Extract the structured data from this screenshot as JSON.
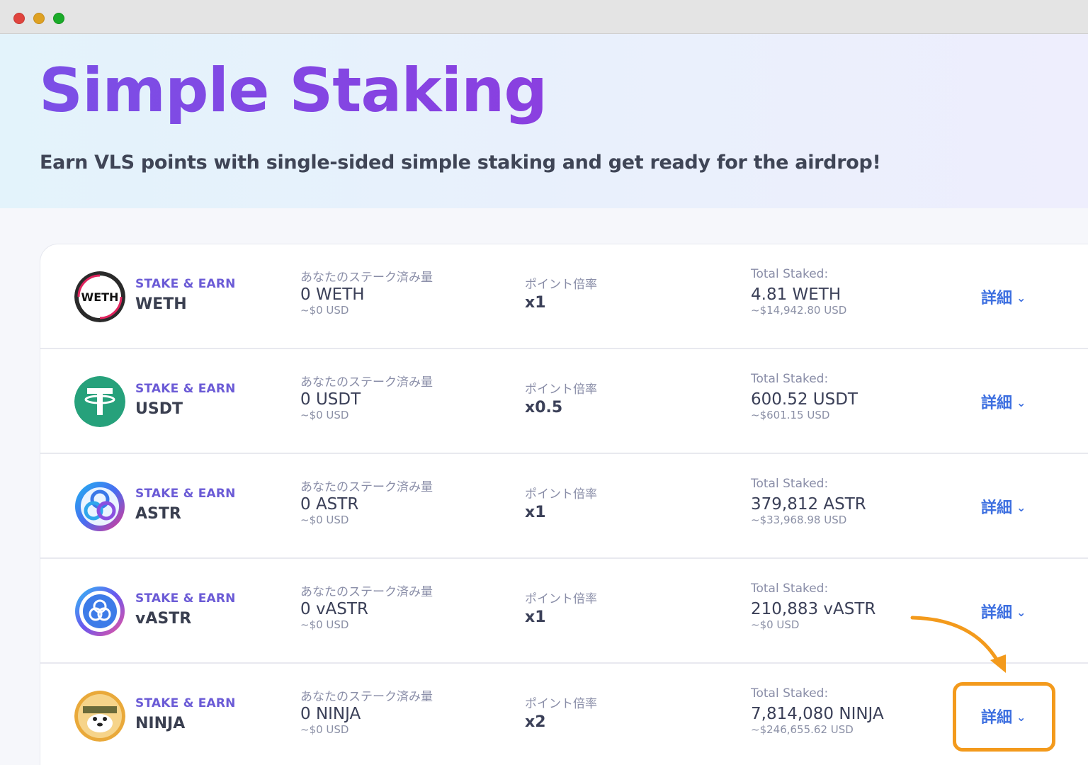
{
  "window": {
    "controls": [
      "close",
      "minimize",
      "maximize"
    ]
  },
  "hero": {
    "title": "Simple Staking",
    "subtitle": "Earn VLS points with single-sided simple staking and get ready for the airdrop!"
  },
  "labels": {
    "stake_earn": "STAKE & EARN",
    "your_staked": "あなたのステーク済み量",
    "multiplier": "ポイント倍率",
    "total_staked": "Total Staked:",
    "details": "詳細"
  },
  "rows": [
    {
      "token": "WETH",
      "logo_icon": "weth-logo-icon",
      "my_amount": "0 WETH",
      "my_usd": "~$0 USD",
      "multiplier": "x1",
      "total": "4.81 WETH",
      "total_usd": "~$14,942.80 USD"
    },
    {
      "token": "USDT",
      "logo_icon": "usdt-logo-icon",
      "my_amount": "0 USDT",
      "my_usd": "~$0 USD",
      "multiplier": "x0.5",
      "total": "600.52 USDT",
      "total_usd": "~$601.15 USD"
    },
    {
      "token": "ASTR",
      "logo_icon": "astr-logo-icon",
      "my_amount": "0 ASTR",
      "my_usd": "~$0 USD",
      "multiplier": "x1",
      "total": "379,812 ASTR",
      "total_usd": "~$33,968.98 USD"
    },
    {
      "token": "vASTR",
      "logo_icon": "vastr-logo-icon",
      "my_amount": "0 vASTR",
      "my_usd": "~$0 USD",
      "multiplier": "x1",
      "total": "210,883 vASTR",
      "total_usd": "~$0 USD"
    },
    {
      "token": "NINJA",
      "logo_icon": "ninja-logo-icon",
      "my_amount": "0 NINJA",
      "my_usd": "~$0 USD",
      "multiplier": "x2",
      "total": "7,814,080 NINJA",
      "total_usd": "~$246,655.62 USD"
    }
  ],
  "colors": {
    "accent_purple": "#7b4fe6",
    "details_blue": "#3d6fe0",
    "highlight_orange": "#f39a1c"
  }
}
